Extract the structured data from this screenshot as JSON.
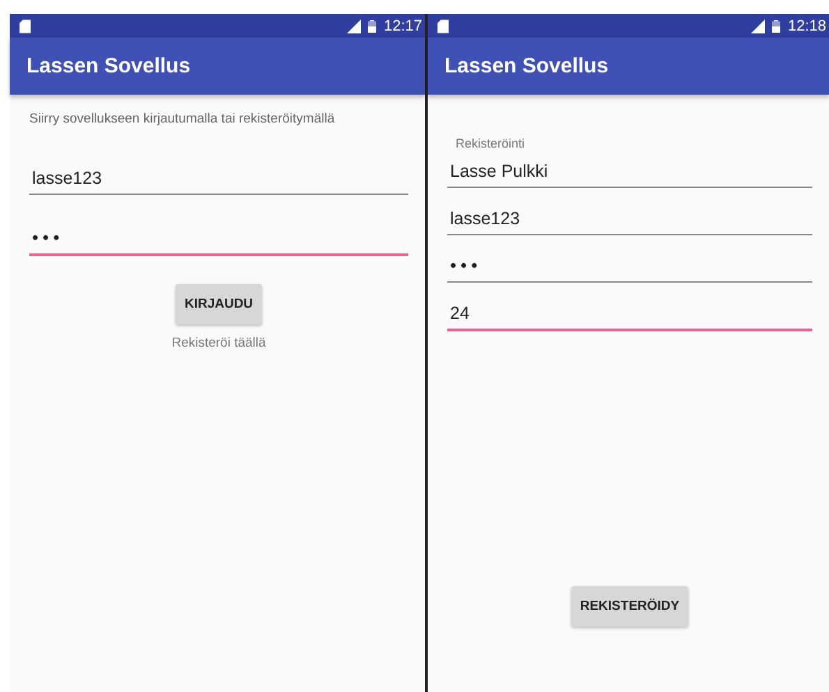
{
  "screens": [
    {
      "status_bar": {
        "time": "12:17"
      },
      "app_bar": {
        "title": "Lassen Sovellus"
      },
      "kind": "login",
      "intro": "Siirry sovellukseen kirjautumalla tai rekisteröitymällä",
      "fields": [
        {
          "kind": "text",
          "value": "lasse123",
          "focused": false
        },
        {
          "kind": "password",
          "value": "•••",
          "focused": true
        }
      ],
      "button": "KIRJAUDU",
      "link": "Rekisteröi täällä"
    },
    {
      "status_bar": {
        "time": "12:18"
      },
      "app_bar": {
        "title": "Lassen Sovellus"
      },
      "kind": "register",
      "heading": "Rekisteröinti",
      "fields": [
        {
          "kind": "text",
          "value": "Lasse Pulkki",
          "focused": false
        },
        {
          "kind": "text",
          "value": "lasse123",
          "focused": false
        },
        {
          "kind": "password",
          "value": "•••",
          "focused": false
        },
        {
          "kind": "text",
          "value": "24",
          "focused": true
        }
      ],
      "button": "REKISTERÖIDY"
    }
  ]
}
